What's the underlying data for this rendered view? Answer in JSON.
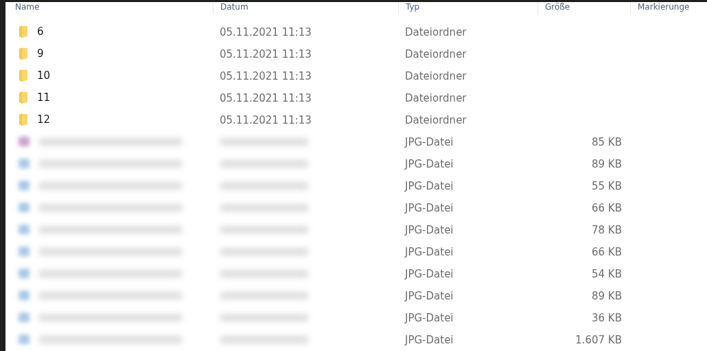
{
  "columns": [
    "Name",
    "Datum",
    "Typ",
    "Größe",
    "Markierunge"
  ],
  "rows": [
    {
      "kind": "folder",
      "name": "6",
      "date": "05.11.2021 11:13",
      "type": "Dateiordner"
    },
    {
      "kind": "folder",
      "name": "9",
      "date": "05.11.2021 11:13",
      "type": "Dateiordner"
    },
    {
      "kind": "folder",
      "name": "10",
      "date": "05.11.2021 11:13",
      "type": "Dateiordner"
    },
    {
      "kind": "folder",
      "name": "11",
      "date": "05.11.2021 11:13",
      "type": "Dateiordner"
    },
    {
      "kind": "folder",
      "name": "12",
      "date": "05.11.2021 11:13",
      "type": "Dateiordner"
    },
    {
      "kind": "file",
      "color": "#c8a2cc",
      "type": "JPG-Datei",
      "size": "85 KB"
    },
    {
      "kind": "file",
      "color": "#a8c8e6",
      "type": "JPG-Datei",
      "size": "89 KB"
    },
    {
      "kind": "file",
      "color": "#a8c8e6",
      "type": "JPG-Datei",
      "size": "55 KB"
    },
    {
      "kind": "file",
      "color": "#a8c8e6",
      "type": "JPG-Datei",
      "size": "66 KB"
    },
    {
      "kind": "file",
      "color": "#a8c8e6",
      "type": "JPG-Datei",
      "size": "78 KB"
    },
    {
      "kind": "file",
      "color": "#a8c8e6",
      "type": "JPG-Datei",
      "size": "66 KB"
    },
    {
      "kind": "file",
      "color": "#a8c8e6",
      "type": "JPG-Datei",
      "size": "54 KB"
    },
    {
      "kind": "file",
      "color": "#a8c8e6",
      "type": "JPG-Datei",
      "size": "89 KB"
    },
    {
      "kind": "file",
      "color": "#a8c8e6",
      "type": "JPG-Datei",
      "size": "36 KB"
    },
    {
      "kind": "file",
      "color": "#a8c8e6",
      "type": "JPG-Datei",
      "size": "1.607 KB"
    }
  ]
}
